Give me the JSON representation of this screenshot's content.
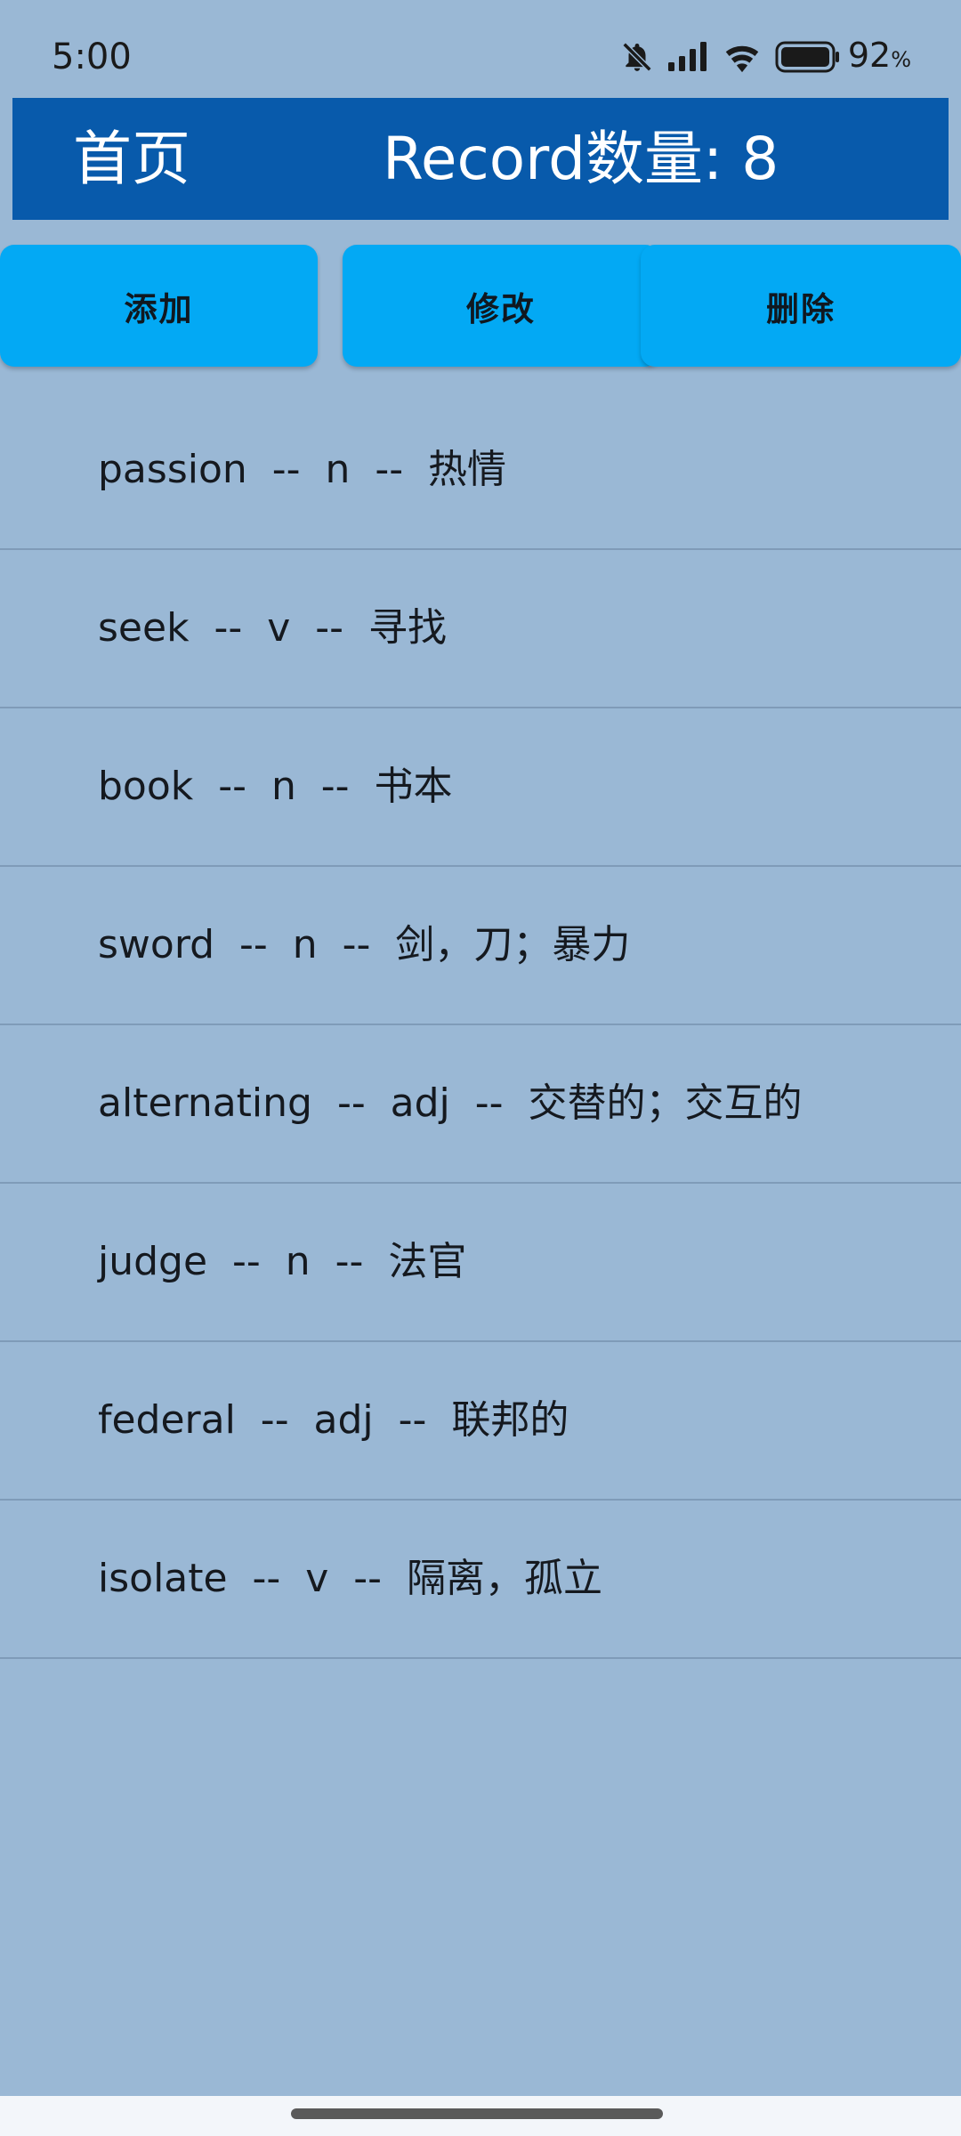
{
  "status_bar": {
    "time": "5:00",
    "battery_percent": "92",
    "battery_unit": "%",
    "icons": [
      "bell-muted-icon",
      "signal-icon",
      "wifi-icon",
      "battery-icon"
    ]
  },
  "header": {
    "home_label": "首页",
    "record_count_label": "Record数量: 8"
  },
  "actions": {
    "add_label": "添加",
    "edit_label": "修改",
    "delete_label": "删除"
  },
  "words": [
    {
      "text": "passion  --  n  --  热情"
    },
    {
      "text": "seek  --  v  --  寻找"
    },
    {
      "text": "book  --  n  --  书本"
    },
    {
      "text": "sword  --  n  --  剑，刀；暴力"
    },
    {
      "text": "alternating  --  adj  --  交替的；交互的"
    },
    {
      "text": "judge  --  n  --  法官"
    },
    {
      "text": "federal  --  adj  --  联邦的"
    },
    {
      "text": "isolate  --  v  --  隔离，孤立"
    }
  ],
  "colors": {
    "background": "#9ab8d5",
    "header": "#085aab",
    "button": "#03a9f4"
  }
}
